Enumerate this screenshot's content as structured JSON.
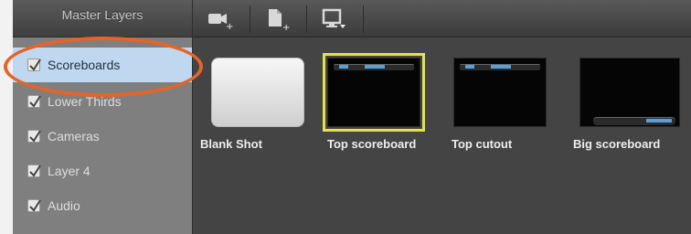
{
  "sidebar": {
    "title": "Master Layers",
    "items": [
      {
        "label": "Scoreboards",
        "checked": true,
        "selected": true
      },
      {
        "label": "Lower Thirds",
        "checked": true
      },
      {
        "label": "Cameras",
        "checked": true
      },
      {
        "label": "Layer 4",
        "checked": true
      },
      {
        "label": "Audio",
        "checked": true
      }
    ]
  },
  "toolbar": {
    "buttons": [
      "video-camera-add-icon",
      "document-add-icon",
      "display-dropdown-icon"
    ]
  },
  "shots": [
    {
      "label": "Blank Shot"
    },
    {
      "label": "Top scoreboard"
    },
    {
      "label": "Top cutout"
    },
    {
      "label": "Big scoreboard"
    }
  ],
  "colors": {
    "selection_outline": "#e2e24a",
    "annotation": "#e4642a",
    "selected_row": "#bfd7ef"
  }
}
